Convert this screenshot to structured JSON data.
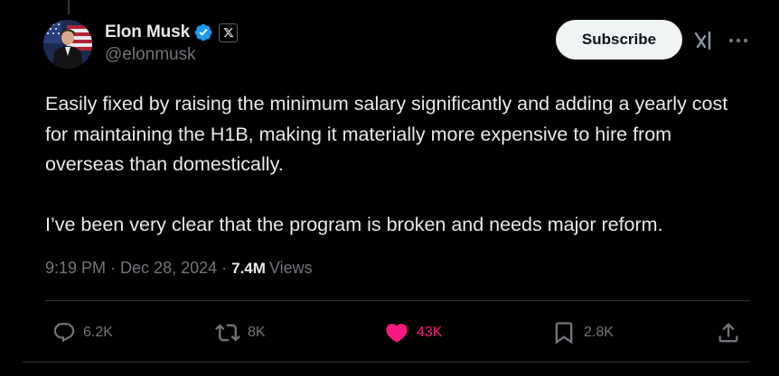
{
  "author": {
    "display_name": "Elon Musk",
    "handle": "@elonmusk",
    "verified": true,
    "affiliation_badge": "x-logo-icon"
  },
  "header_actions": {
    "subscribe_label": "Subscribe",
    "grok_icon": "grok-icon",
    "more_icon": "more-horizontal-icon"
  },
  "tweet": {
    "paragraphs": [
      "Easily fixed by raising the minimum salary significantly and adding a yearly cost for maintaining the H1B, making it materially more expensive to hire from overseas than domestically.",
      "I’ve been very clear that the program is broken and needs major reform."
    ],
    "time": "9:19 PM",
    "separator": "·",
    "date": "Dec 28, 2024",
    "views_count": "7.4M",
    "views_label": "Views"
  },
  "engagement": {
    "replies": "6.2K",
    "reposts": "8K",
    "likes": "43K",
    "bookmarks": "2.8K",
    "liked": true
  },
  "colors": {
    "background": "#000000",
    "text_primary": "#e7e9ea",
    "text_secondary": "#71767b",
    "verified_blue": "#1d9bf0",
    "like_pink": "#f91880",
    "divider": "#2f3336",
    "button_bg": "#eff3f4"
  }
}
